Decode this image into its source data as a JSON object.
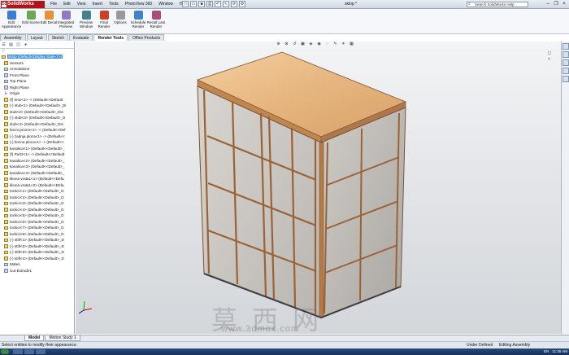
{
  "app": {
    "logo": "SolidWorks",
    "doc_title": "sklop *",
    "help_search_placeholder": "Search SolidWorks Help",
    "menus": [
      "File",
      "Edit",
      "View",
      "Insert",
      "Tools",
      "PhotoView 360",
      "Window",
      "Help"
    ]
  },
  "commands": [
    {
      "label": "Edit Appearance",
      "color": "#3a7bd5"
    },
    {
      "label": "Edit Scene",
      "color": "#6aa84f"
    },
    {
      "label": "Edit Decal",
      "color": "#e69138"
    },
    {
      "label": "Integrated Preview",
      "color": "#8e7cc3"
    },
    {
      "label": "Preview Window",
      "color": "#45818e"
    },
    {
      "label": "Final Render",
      "color": "#cc4125"
    },
    {
      "label": "Options",
      "color": "#999999"
    },
    {
      "label": "Schedule Render",
      "color": "#3d85c6"
    },
    {
      "label": "Recall Last Render",
      "color": "#a64d79"
    }
  ],
  "tabs": [
    "Assembly",
    "Layout",
    "Sketch",
    "Evaluate",
    "Render Tools",
    "Office Products"
  ],
  "active_tab": "Render Tools",
  "tree": [
    {
      "label": "sklop  (Default<Display State-1>)",
      "icon": "y",
      "selected": true
    },
    {
      "label": "Sensors",
      "icon": "y"
    },
    {
      "label": "Annotations",
      "icon": "b"
    },
    {
      "label": "Front Plane",
      "icon": "b"
    },
    {
      "label": "Top Plane",
      "icon": "b"
    },
    {
      "label": "Right Plane",
      "icon": "b"
    },
    {
      "label": "Origin",
      "icon": "o"
    },
    {
      "label": "(f) krov<1> -> (Default<<Default",
      "icon": "y"
    },
    {
      "label": "(-) stub<1> (Default<<Default>_Di",
      "icon": "y"
    },
    {
      "label": "stub<2> (Default<<Default>_Dis",
      "icon": "y"
    },
    {
      "label": "(-) stub<3> (Default<<Default>_D",
      "icon": "y"
    },
    {
      "label": "stub<4> (Default<<Default>_Dis",
      "icon": "y"
    },
    {
      "label": "bocni prozor<1> -> (Default<<Def",
      "icon": "y"
    },
    {
      "label": "(-) zadnja ploca<1> -> (Default<<",
      "icon": "y"
    },
    {
      "label": "(-) bocna ploca<1> -> (Default<<",
      "icon": "y"
    },
    {
      "label": "kanalica<1> (Default<<Default>_",
      "icon": "y"
    },
    {
      "label": "(f) Part2<1> -> (Default<<Default",
      "icon": "y"
    },
    {
      "label": "kanalica<2> (Default<<Default>_",
      "icon": "y"
    },
    {
      "label": "kanalica<3> (Default<<Default>_",
      "icon": "y"
    },
    {
      "label": "kanalica<4> (Default<<Default>_",
      "icon": "y"
    },
    {
      "label": "kliona vrata1<1> (Default<<Defa",
      "icon": "y"
    },
    {
      "label": "kliona vrata1<2> (Default<<Defa",
      "icon": "y"
    },
    {
      "label": "tockici<1> (Default<<Default>_D",
      "icon": "y"
    },
    {
      "label": "tockici<2> (Default<<Default>_D",
      "icon": "y"
    },
    {
      "label": "tockici<3> (Default<<Default>_D",
      "icon": "y"
    },
    {
      "label": "tockici<4> (Default<<Default>_D",
      "icon": "y"
    },
    {
      "label": "tockici<5> (Default<<Default>_D",
      "icon": "y"
    },
    {
      "label": "tockici<6> (Default<<Default>_D",
      "icon": "y"
    },
    {
      "label": "tockici<7> (Default<<Default>_D",
      "icon": "y"
    },
    {
      "label": "tockici<8> (Default<<Default>_D",
      "icon": "y"
    },
    {
      "label": "(-) stift<1> (Default<<Default>_D",
      "icon": "y"
    },
    {
      "label": "(-) stift<2> (Default<<Default>_D",
      "icon": "y"
    },
    {
      "label": "(-) stift<3> (Default<<Default>_D",
      "icon": "y"
    },
    {
      "label": "(-) stift<4> (Default<<Default>_D",
      "icon": "y"
    },
    {
      "label": "Mates",
      "icon": "b"
    },
    {
      "label": "Cut-Extrude1",
      "icon": "b"
    }
  ],
  "bottom_tabs": [
    "Model",
    "Motion Study 1"
  ],
  "status": {
    "message": "Select entities to modify their appearance.",
    "defined": "Under Defined",
    "mode": "Editing Assembly"
  },
  "tray": {
    "lang": "EN",
    "time": "11:36 AM"
  },
  "watermark": {
    "text": "莫西网",
    "url": "www.3dmox.com"
  }
}
